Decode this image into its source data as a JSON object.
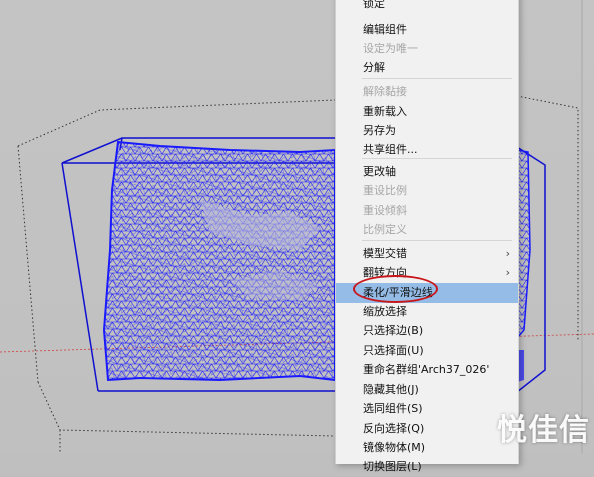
{
  "context_menu": {
    "items": [
      {
        "label": "锁定",
        "enabled": true
      },
      {
        "label": "编辑组件",
        "enabled": true
      },
      {
        "label": "设定为唯一",
        "enabled": false
      },
      {
        "label": "分解",
        "enabled": true
      },
      {
        "label": "解除黏接",
        "enabled": false
      },
      {
        "label": "重新载入",
        "enabled": true
      },
      {
        "label": "另存为",
        "enabled": true
      },
      {
        "label": "共享组件...",
        "enabled": true
      },
      {
        "label": "更改轴",
        "enabled": true
      },
      {
        "label": "重设比例",
        "enabled": false
      },
      {
        "label": "重设倾斜",
        "enabled": false
      },
      {
        "label": "比例定义",
        "enabled": false
      },
      {
        "label": "模型交错",
        "enabled": true,
        "submenu": true
      },
      {
        "label": "翻转方向",
        "enabled": true,
        "submenu": true
      },
      {
        "label": "柔化/平滑边线",
        "enabled": true,
        "highlighted": true
      },
      {
        "label": "缩放选择",
        "enabled": true
      },
      {
        "label": "只选择边(B)",
        "enabled": true
      },
      {
        "label": "只选择面(U)",
        "enabled": true
      },
      {
        "label": "重命名群组'Arch37_026'",
        "enabled": true
      },
      {
        "label": "隐藏其他(J)",
        "enabled": true
      },
      {
        "label": "选同组件(S)",
        "enabled": true
      },
      {
        "label": "反向选择(Q)",
        "enabled": true
      },
      {
        "label": "镜像物体(M)",
        "enabled": true
      },
      {
        "label": "切换图层(L)",
        "enabled": true
      }
    ],
    "submenu_arrow": "›"
  },
  "watermark": "悦佳信",
  "colors": {
    "mesh": "#1a1aff",
    "bounding_box": "#1010d0",
    "highlight": "#94bce6",
    "annotation": "#c8161b",
    "viewport": "#c2c2c2"
  }
}
